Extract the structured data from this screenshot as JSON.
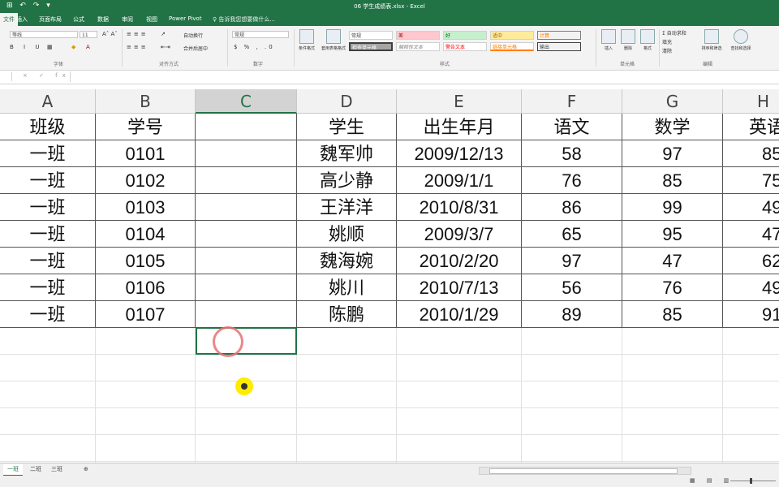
{
  "window": {
    "title": "06 学生成绩表.xlsx - Excel",
    "quick_access": "⊞ ↶ ↷ ▾"
  },
  "ribbon_tabs": [
    "文件",
    "插入",
    "页面布局",
    "公式",
    "数据",
    "审阅",
    "视图",
    "Power Pivot"
  ],
  "tell_me": "♀ 告诉我您想要做什么...",
  "ribbon": {
    "font_name": "等线",
    "font_size": "11",
    "number_format": "常规",
    "wrap_text": "自动换行",
    "merge_center": "合并后居中",
    "cond_format": "条件格式",
    "table_format": "套用表格格式",
    "styles": [
      "常规",
      "差",
      "好",
      "适中",
      "计算",
      "检查单元格",
      "解释性文本",
      "警告文本",
      "链接单元格",
      "输出"
    ],
    "insert": "插入",
    "delete": "删除",
    "format": "格式",
    "autosum": "Σ 自动求和",
    "fill": "填充",
    "clear": "清除",
    "sort_filter": "排序和筛选",
    "find_select": "查找和选择",
    "group_labels": {
      "font": "字体",
      "alignment": "对齐方式",
      "number": "数字",
      "styles": "样式",
      "cells": "单元格",
      "editing": "编辑"
    }
  },
  "formula_bar": {
    "buttons": "× ✓ fx",
    "value": ""
  },
  "columns": [
    "A",
    "B",
    "C",
    "D",
    "E",
    "F",
    "G",
    "H"
  ],
  "active_column": "C",
  "table": {
    "header": [
      "班级",
      "学号",
      "",
      "学生",
      "出生年月",
      "语文",
      "数学",
      "英语"
    ],
    "rows": [
      [
        "一班",
        "0101",
        "",
        "魏军帅",
        "2009/12/13",
        "58",
        "97",
        "85"
      ],
      [
        "一班",
        "0102",
        "",
        "高少静",
        "2009/1/1",
        "76",
        "85",
        "75"
      ],
      [
        "一班",
        "0103",
        "",
        "王洋洋",
        "2010/8/31",
        "86",
        "99",
        "49"
      ],
      [
        "一班",
        "0104",
        "",
        "姚顺",
        "2009/3/7",
        "65",
        "95",
        "47"
      ],
      [
        "一班",
        "0105",
        "",
        "魏海婉",
        "2010/2/20",
        "97",
        "47",
        "62"
      ],
      [
        "一班",
        "0106",
        "",
        "姚川",
        "2010/7/13",
        "56",
        "76",
        "49"
      ],
      [
        "一班",
        "0107",
        "",
        "陈鹏",
        "2010/1/29",
        "89",
        "85",
        "91"
      ]
    ]
  },
  "sheets": [
    "一班",
    "二班",
    "三班"
  ],
  "active_sheet": "一班",
  "add_sheet": "⊕",
  "status": {
    "views": "▦ ▤ ▥"
  },
  "colors": {
    "excel_green": "#217346",
    "cursor_highlight": "#ffeb00",
    "click_ring": "#e57373"
  }
}
